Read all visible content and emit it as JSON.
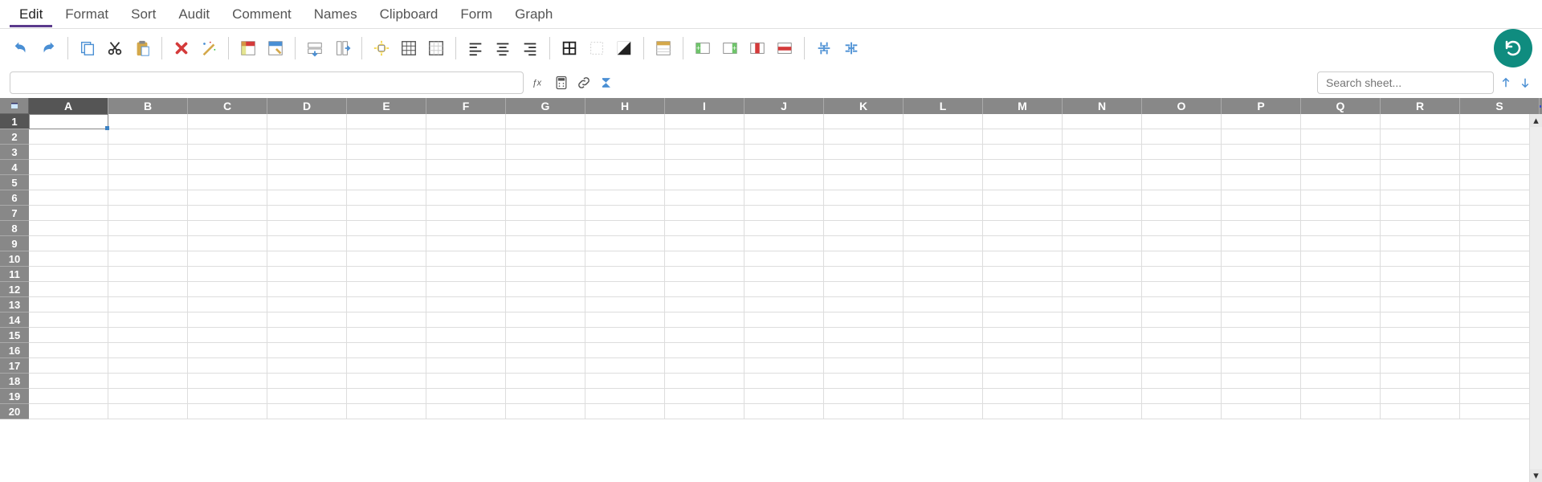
{
  "menu": {
    "items": [
      {
        "label": "Edit",
        "active": true
      },
      {
        "label": "Format",
        "active": false
      },
      {
        "label": "Sort",
        "active": false
      },
      {
        "label": "Audit",
        "active": false
      },
      {
        "label": "Comment",
        "active": false
      },
      {
        "label": "Names",
        "active": false
      },
      {
        "label": "Clipboard",
        "active": false
      },
      {
        "label": "Form",
        "active": false
      },
      {
        "label": "Graph",
        "active": false
      }
    ]
  },
  "toolbar": {
    "groups": [
      [
        "undo",
        "redo"
      ],
      [
        "copy",
        "cut",
        "paste"
      ],
      [
        "delete",
        "wizard"
      ],
      [
        "fill-color",
        "format-cell"
      ],
      [
        "insert-row",
        "insert-col"
      ],
      [
        "sun",
        "grid-all",
        "grid-outer"
      ],
      [
        "align-left",
        "align-center",
        "align-right"
      ],
      [
        "borders",
        "no-border",
        "diag"
      ],
      [
        "table-style"
      ],
      [
        "add-col-left",
        "add-col-right",
        "del-col",
        "del-row"
      ],
      [
        "freeze-h",
        "freeze-v"
      ]
    ]
  },
  "formula_bar": {
    "value": "",
    "icons": [
      "fx",
      "calc",
      "link",
      "sum"
    ]
  },
  "search": {
    "placeholder": "Search sheet..."
  },
  "grid": {
    "columns": [
      "A",
      "B",
      "C",
      "D",
      "E",
      "F",
      "G",
      "H",
      "I",
      "J",
      "K",
      "L",
      "M",
      "N",
      "O",
      "P",
      "Q",
      "R",
      "S"
    ],
    "rows": [
      1,
      2,
      3,
      4,
      5,
      6,
      7,
      8,
      9,
      10,
      11,
      12,
      13,
      14,
      15,
      16,
      17,
      18,
      19,
      20
    ],
    "active_cell": {
      "col": "A",
      "row": 1
    }
  }
}
